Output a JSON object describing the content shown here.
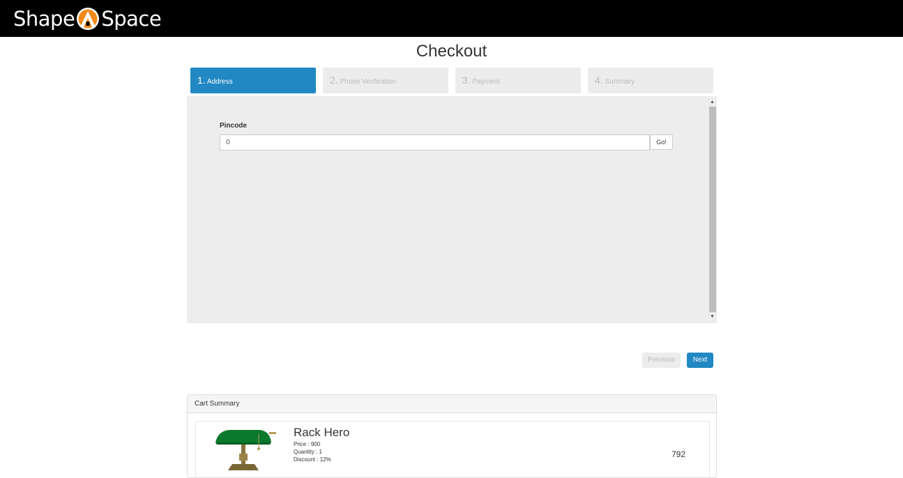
{
  "header": {
    "logo_left": "Shape",
    "logo_right": "Space"
  },
  "page": {
    "title": "Checkout"
  },
  "steps": [
    {
      "num": "1.",
      "label": "Address",
      "active": true
    },
    {
      "num": "2.",
      "label": "Phone Verification",
      "active": false
    },
    {
      "num": "3.",
      "label": "Payment",
      "active": false
    },
    {
      "num": "4.",
      "label": "Summary",
      "active": false
    }
  ],
  "address_form": {
    "pincode_label": "Pincode",
    "pincode_value": "0",
    "go_label": "Go!"
  },
  "nav": {
    "previous_label": "Previous",
    "next_label": "Next"
  },
  "cart": {
    "title": "Cart Summary",
    "items": [
      {
        "name": "Rack Hero",
        "price": "Price : 900",
        "quantity": "Quantity : 1",
        "discount": "Discount : 12%",
        "total": "792"
      }
    ]
  },
  "colors": {
    "primary": "#2288c4",
    "logo_accent": "#f08a1c",
    "topbar": "#000000"
  }
}
